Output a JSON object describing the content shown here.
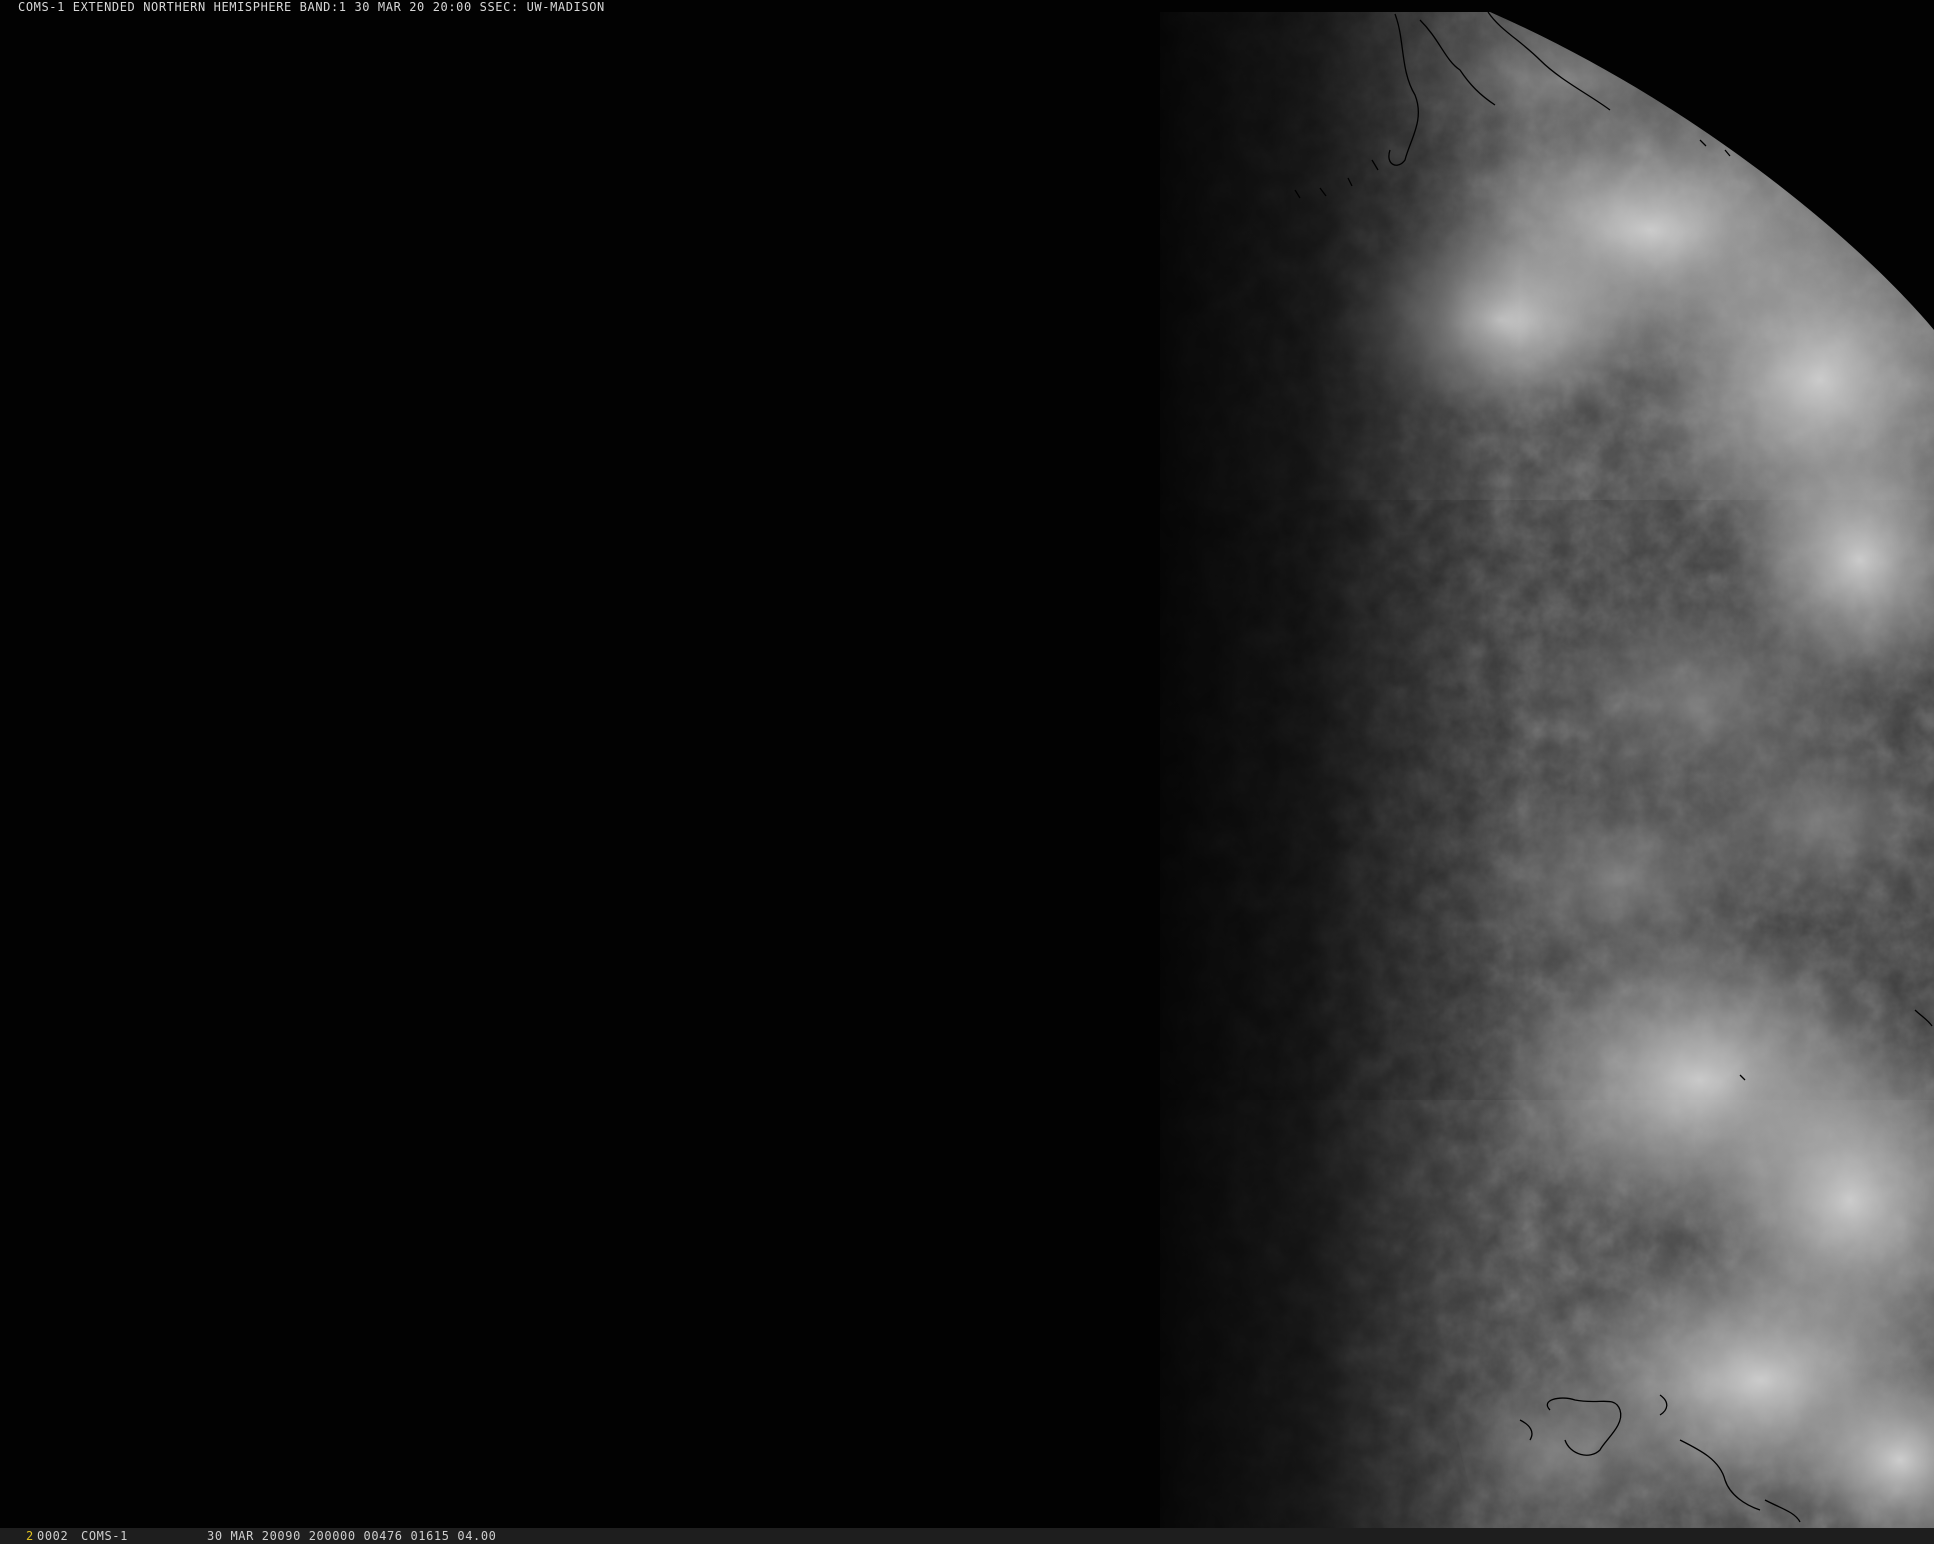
{
  "title": "COMS-1 EXTENDED NORTHERN HEMISPHERE BAND:1 30 MAR 20 20:00 SSEC: UW-MADISON",
  "status_bar": {
    "frame_number": "2",
    "frame_id": "0002",
    "satellite": "COMS-1",
    "image_info": "30 MAR 20090 200000 00476 01615 04.00"
  },
  "colors": {
    "background": "#000000",
    "status_bar_bg": "#1e1e1e",
    "frame_number": "#e0c020",
    "text": "#d8d8d8",
    "coastline": "#000000"
  },
  "scene": "visible satellite image: night side dark, sunlit Earth limb on the right with clouds and coastlines"
}
